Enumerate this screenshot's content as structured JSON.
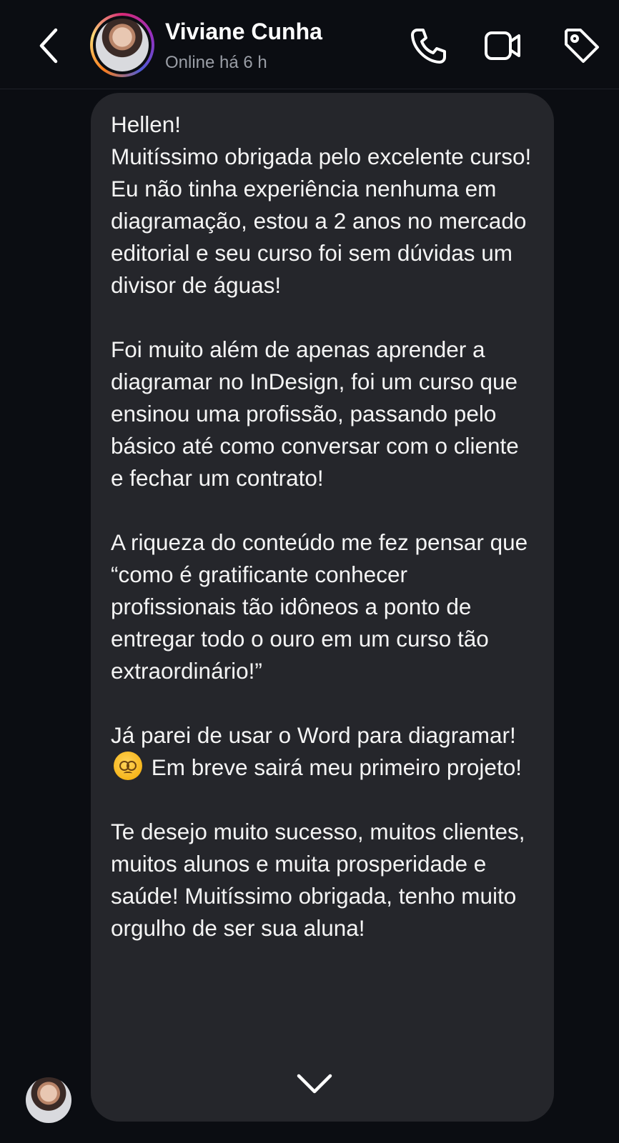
{
  "header": {
    "back_icon": "chevron-left-icon",
    "contact_name": "Viviane Cunha",
    "status": "Online há 6 h",
    "actions": {
      "call_icon": "phone-icon",
      "video_icon": "video-camera-icon",
      "tag_icon": "tag-icon"
    }
  },
  "message": {
    "p1": "Hellen!\nMuitíssimo obrigada pelo excelente curso! Eu não tinha experiência nenhuma em diagramação, estou a 2 anos no mercado editorial e seu curso foi sem dúvidas um divisor de águas!",
    "p2": "Foi muito além de apenas aprender a diagramar no InDesign, foi um curso que ensinou uma profissão, passando pelo básico até como conversar com o cliente e fechar um contrato!",
    "p3": "A riqueza do conteúdo me fez pensar que “como é gratificante conhecer profissionais tão idôneos a ponto de entregar todo o ouro em um curso tão extraordinário!”",
    "p4_before": "Já parei de usar o Word para diagramar!",
    "p4_emoji": "dizzy-face-emoji",
    "p4_after": "Em breve sairá meu primeiro projeto!",
    "p5": "Te desejo muito sucesso, muitos clientes, muitos alunos e muita prosperidade e saúde! Muitíssimo obrigada, tenho muito orgulho de ser sua aluna!"
  },
  "scroll_icon": "chevron-down-icon",
  "colors": {
    "background": "#0b0d12",
    "bubble": "#25262b",
    "text": "#f4f4f4",
    "status": "#9a9ea6"
  }
}
